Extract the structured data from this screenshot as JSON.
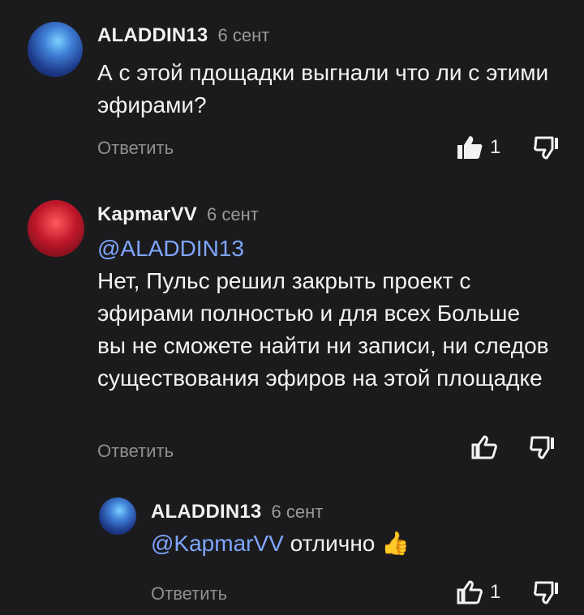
{
  "comments": [
    {
      "author": "ALADDIN13",
      "date": "6 сент",
      "text": "А с этой пдощадки выгнали что ли с этими эфирами?",
      "reply_label": "Ответить",
      "likes": "1"
    },
    {
      "author": "KapmarVV",
      "date": "6 сент",
      "mention": "@ALADDIN13",
      "text": "Нет, Пульс решил закрыть проект с эфирами полностью и для всех Больше вы не сможете найти ни записи, ни следов существования эфиров на этой площадке",
      "reply_label": "Ответить"
    },
    {
      "author": "ALADDIN13",
      "date": "6 сент",
      "mention": "@KapmarVV",
      "text": "отлично",
      "emoji": "👍",
      "reply_label": "Ответить",
      "likes": "1"
    }
  ],
  "colors": {
    "background": "#1b1b1d",
    "mention": "#7fa6ff",
    "muted": "#9a9a9a"
  }
}
